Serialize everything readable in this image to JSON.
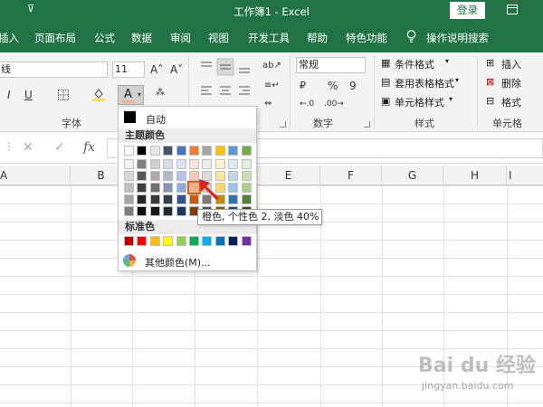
{
  "window": {
    "title": "工作簿1  -  Excel",
    "qat_caret": "⊽",
    "login_label": "登录"
  },
  "tabs": [
    "插入",
    "页面布局",
    "公式",
    "数据",
    "审阅",
    "视图",
    "开发工具",
    "帮助",
    "特色功能"
  ],
  "tell_me": "操作说明搜索",
  "ribbon": {
    "font_name_fragment": "线",
    "font_size": "11",
    "grow_font": "A˄",
    "shrink_font": "A˅",
    "italic": "I",
    "underline": "U",
    "font_group_label": "字体",
    "number_format": "常规",
    "currency": "₽",
    "percent": "%",
    "comma": "9",
    "number_group_label": "数字",
    "conditional_format": "条件格式",
    "format_as_table": "套用表格格式",
    "cell_styles": "单元格样式",
    "styles_group_label": "样式",
    "insert": "插入",
    "delete": "删除",
    "format": "格式",
    "cells_group_label": "单元格"
  },
  "formula_bar": {
    "cancel": "✕",
    "enter": "✓",
    "fx": "fx"
  },
  "columns": [
    "A",
    "B",
    "E",
    "F",
    "G",
    "H",
    "I"
  ],
  "color_picker": {
    "automatic_label": "自动",
    "theme_colors_title": "主题颜色",
    "standard_colors_title": "标准色",
    "more_colors_label": "其他颜色(M)...",
    "theme_top": [
      "#FFFFFF",
      "#000000",
      "#E7E6E6",
      "#44546A",
      "#4472C4",
      "#ED7D31",
      "#A5A5A5",
      "#FFC000",
      "#5B9BD5",
      "#70AD47"
    ],
    "theme_shades": [
      [
        "#F2F2F2",
        "#808080",
        "#D0CECE",
        "#D6DCE4",
        "#D9E2F3",
        "#FBE5D5",
        "#EDEDED",
        "#FFF2CC",
        "#DEEAF6",
        "#E2EFD9"
      ],
      [
        "#D8D8D8",
        "#595959",
        "#AEAAAA",
        "#ADB9CA",
        "#B4C6E7",
        "#F7CAAC",
        "#DBDBDB",
        "#FFE598",
        "#BDD7EE",
        "#C5E0B3"
      ],
      [
        "#BFBFBF",
        "#3F3F3F",
        "#757070",
        "#8496B0",
        "#8EAADB",
        "#F4B083",
        "#C9C9C9",
        "#FFD965",
        "#9CC2E5",
        "#A8D08D"
      ],
      [
        "#A5A5A5",
        "#262626",
        "#3A3838",
        "#323F4F",
        "#2F5496",
        "#C55A11",
        "#7B7B7B",
        "#BF9000",
        "#2E75B5",
        "#538135"
      ],
      [
        "#7F7F7F",
        "#0D0D0D",
        "#171616",
        "#222A35",
        "#1F3864",
        "#833C0B",
        "#525252",
        "#7F6000",
        "#1E4E79",
        "#375623"
      ]
    ],
    "standard": [
      "#C00000",
      "#FF0000",
      "#FFC000",
      "#FFFF00",
      "#92D050",
      "#00B050",
      "#00B0F0",
      "#0070C0",
      "#002060",
      "#7030A0"
    ]
  },
  "tooltip": "橙色, 个性色 2, 淡色 40%",
  "watermark": {
    "main": "Bai du 经验",
    "sub": "jingyan.baidu.com"
  }
}
